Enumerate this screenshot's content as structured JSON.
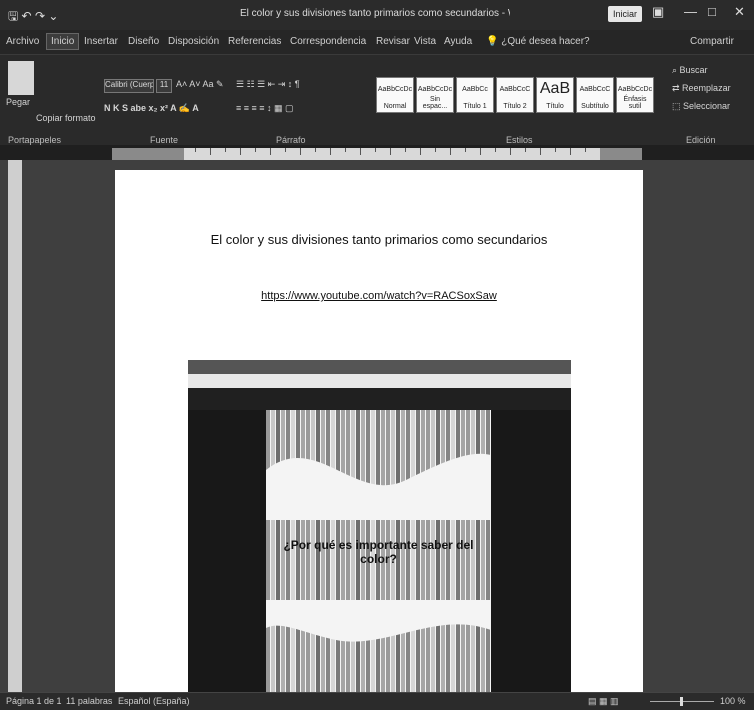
{
  "window": {
    "title": "El color y sus divisiones tanto primarios como secundarios - Word",
    "signin_label": "Iniciar",
    "controls": [
      "—",
      "□",
      "✕"
    ]
  },
  "menu": {
    "tabs": [
      "Archivo",
      "Inicio",
      "Insertar",
      "Diseño",
      "Disposición",
      "Referencias",
      "Correspondencia",
      "Revisar",
      "Vista",
      "Ayuda",
      "¿Qué desea hacer?"
    ],
    "share_label": "Compartir"
  },
  "ribbon": {
    "paste_label": "Pegar",
    "copy_format_label": "Copiar formato",
    "font_name": "Calibri (Cuerpo)",
    "font_size": "11",
    "styles": [
      {
        "sample": "AaBbCcDc",
        "label": "Normal"
      },
      {
        "sample": "AaBbCcDc",
        "label": "Sin espac..."
      },
      {
        "sample": "AaBbCc",
        "label": "Título 1"
      },
      {
        "sample": "AaBbCcC",
        "label": "Título 2"
      },
      {
        "sample": "AaB",
        "label": "Título"
      },
      {
        "sample": "AaBbCcC",
        "label": "Subtítulo"
      },
      {
        "sample": "AaBbCcDc",
        "label": "Énfasis sutil"
      }
    ],
    "find_label": "Buscar",
    "replace_label": "Reemplazar",
    "select_label": "Seleccionar",
    "groups": [
      "Portapapeles",
      "Fuente",
      "Párrafo",
      "Estilos",
      "Edición"
    ]
  },
  "document": {
    "title": "El color y sus divisiones tanto primarios como secundarios",
    "link": "https://www.youtube.com/watch?v=RACSoxSaw",
    "embedded_video_text": "¿Por qué es importante saber del color?"
  },
  "status": {
    "page": "Página 1 de 1",
    "words": "11 palabras",
    "language": "Español (España)",
    "zoom": "100 %"
  }
}
